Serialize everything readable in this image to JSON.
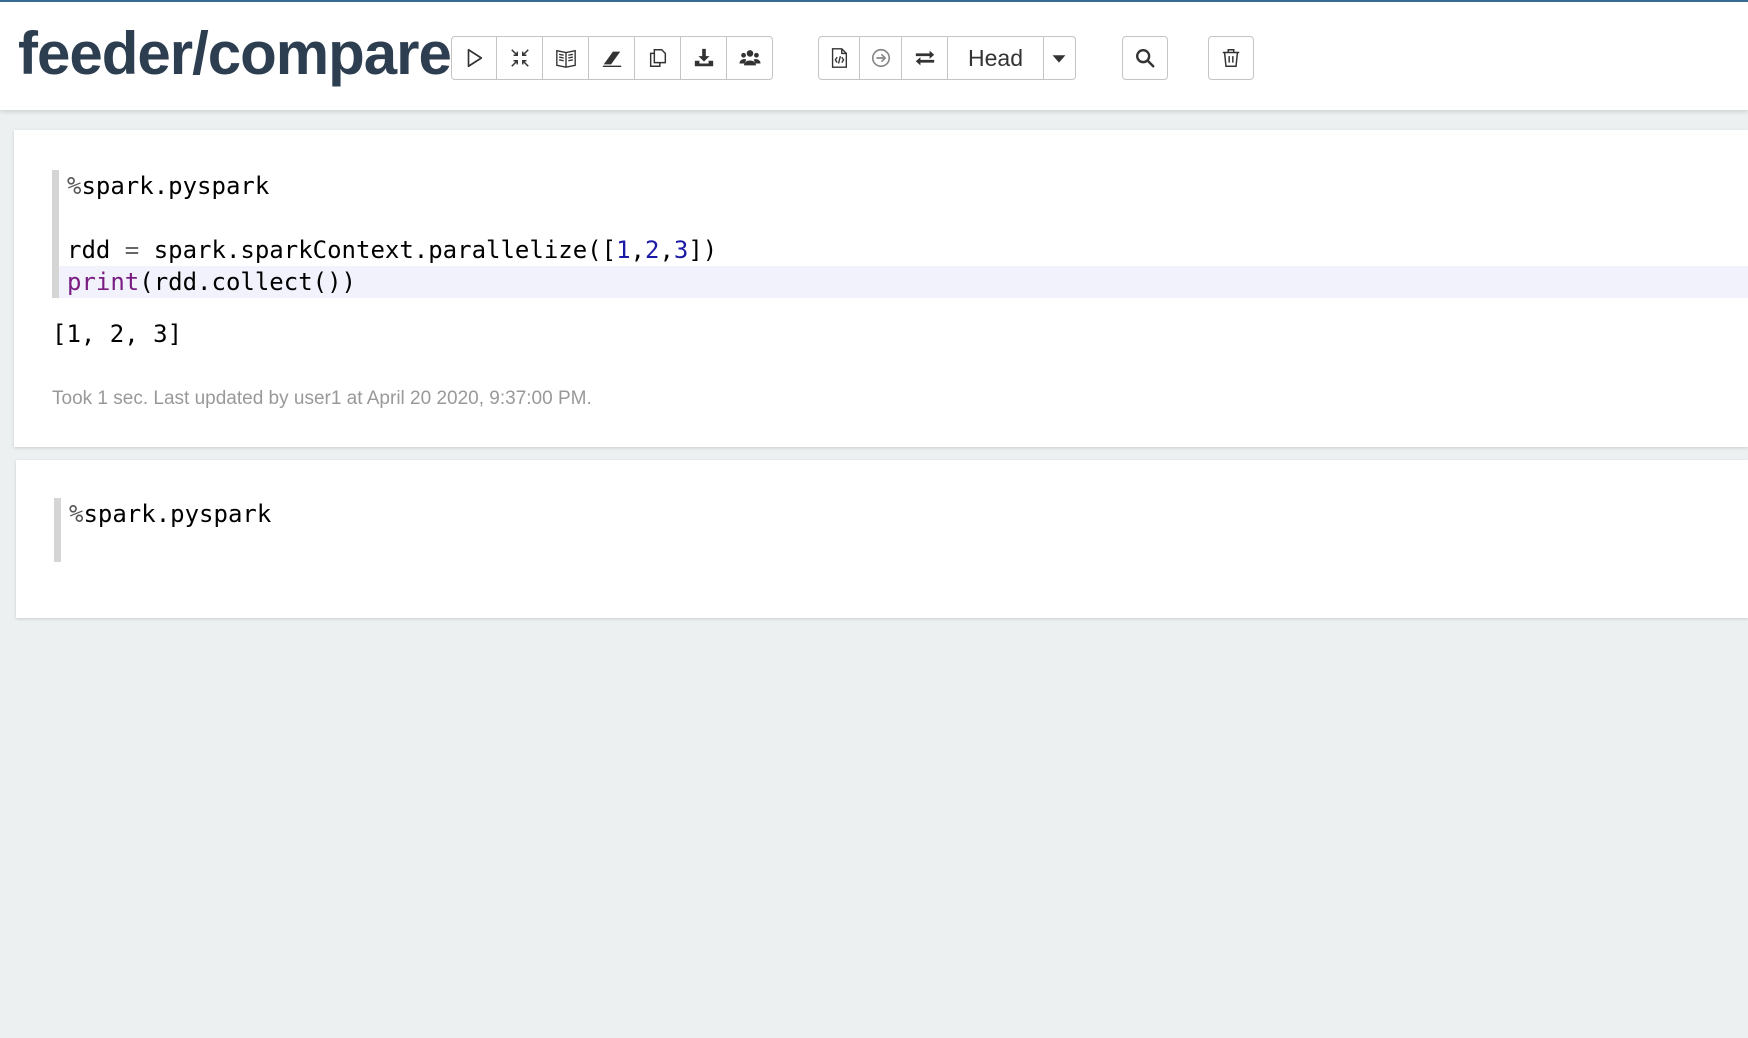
{
  "notebook": {
    "title": "feeder/compare"
  },
  "toolbar": {
    "group1": [
      {
        "name": "run-all-button",
        "icon": "play-icon"
      },
      {
        "name": "hide-code-button",
        "icon": "compress-icon"
      },
      {
        "name": "hide-output-button",
        "icon": "book-icon"
      },
      {
        "name": "clear-output-button",
        "icon": "eraser-icon"
      },
      {
        "name": "clone-button",
        "icon": "copy-icon"
      },
      {
        "name": "export-button",
        "icon": "download-icon"
      },
      {
        "name": "permissions-button",
        "icon": "users-icon"
      }
    ],
    "version_control_label": "Head",
    "group2": [
      {
        "name": "commit-button",
        "icon": "file-code-icon"
      },
      {
        "name": "revision-button",
        "icon": "arrow-circle-icon"
      },
      {
        "name": "compare-button",
        "icon": "exchange-icon"
      }
    ]
  },
  "paragraphs": [
    {
      "code_lines": [
        "%spark.pyspark",
        "",
        "rdd = spark.sparkContext.parallelize([1,2,3])",
        "print(rdd.collect())"
      ],
      "output": "[1, 2, 3]",
      "status": "Took 1 sec. Last updated by user1 at April 20 2020, 9:37:00 PM."
    },
    {
      "code_lines": [
        "%spark.pyspark",
        ""
      ]
    }
  ],
  "colors": {
    "title": "#2c3e50",
    "accent_border": "#3a6b94",
    "background": "#ecf0f1"
  }
}
